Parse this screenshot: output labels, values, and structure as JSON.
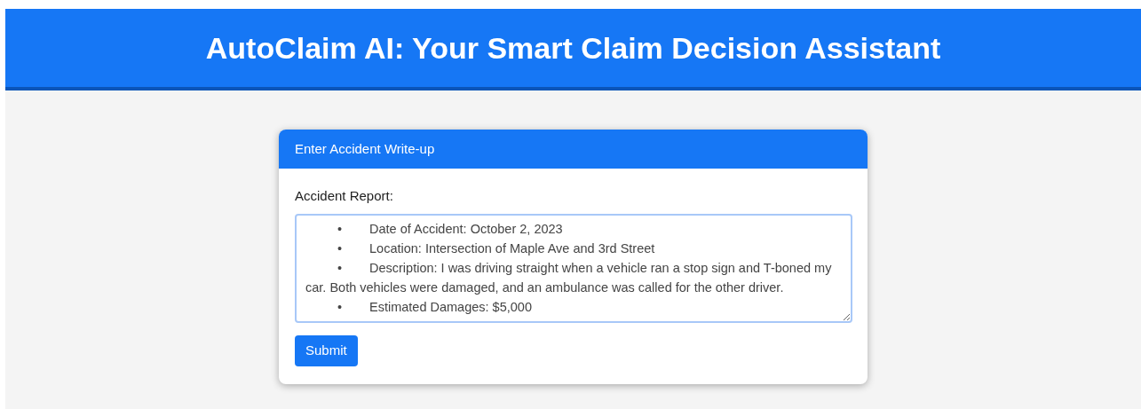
{
  "header": {
    "title": "AutoClaim AI: Your Smart Claim Decision Assistant"
  },
  "card": {
    "title": "Enter Accident Write-up",
    "field": {
      "label": "Accident Report:",
      "value_lines": [
        "\t•\tDate of Accident: October 2, 2023",
        "\t•\tLocation: Intersection of Maple Ave and 3rd Street",
        "\t•\tDescription: I was driving straight when a vehicle ran a stop sign and T-boned my car. Both vehicles were damaged, and an ambulance was called for the other driver.",
        "\t•\tEstimated Damages: $5,000"
      ]
    },
    "button": "Submit"
  }
}
